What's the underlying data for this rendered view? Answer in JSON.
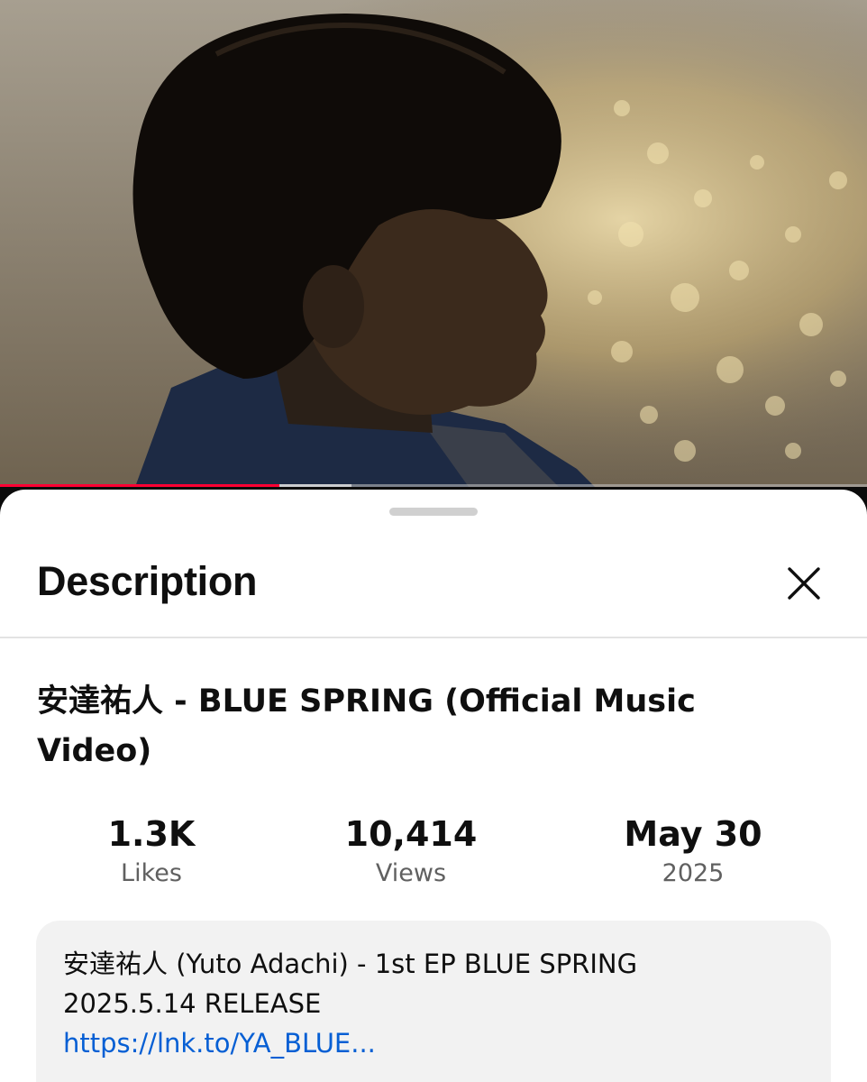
{
  "player": {
    "progress_percent": 32.2,
    "buffered_percent": 40.5,
    "progress_color": "#ff0033"
  },
  "sheet": {
    "title": "Description",
    "close_icon": "close-icon"
  },
  "video": {
    "title": "安達祐人 - BLUE SPRING (Official Music Video)"
  },
  "stats": [
    {
      "value": "1.3K",
      "label": "Likes"
    },
    {
      "value": "10,414",
      "label": "Views"
    },
    {
      "value": "May 30",
      "label": "2025"
    }
  ],
  "description": {
    "line1": "安達祐人 (Yuto Adachi) - 1st EP BLUE SPRING",
    "line2": "2025.5.14 RELEASE",
    "link": "https://lnk.to/YA_BLUE..."
  }
}
